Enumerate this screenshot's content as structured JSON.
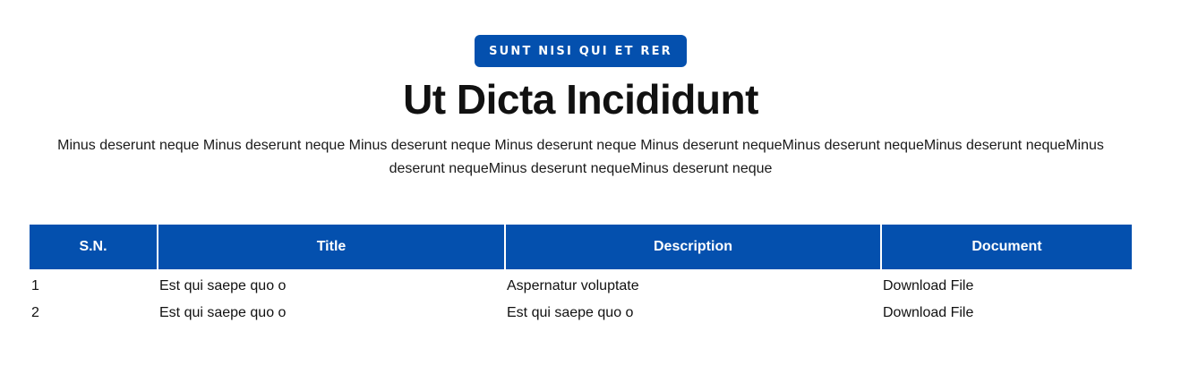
{
  "section": {
    "badge": "SUNT NISI QUI ET RER",
    "title": "Ut Dicta Incididunt",
    "description": "Minus deserunt neque Minus deserunt neque Minus deserunt neque Minus deserunt neque Minus deserunt nequeMinus deserunt nequeMinus deserunt nequeMinus deserunt nequeMinus deserunt nequeMinus deserunt neque"
  },
  "table": {
    "headers": {
      "sn": "S.N.",
      "title": "Title",
      "description": "Description",
      "document": "Document"
    },
    "rows": [
      {
        "sn": "1",
        "title": "Est qui saepe quo o",
        "description": "Aspernatur voluptate",
        "document": "Download File"
      },
      {
        "sn": "2",
        "title": "Est qui saepe quo o",
        "description": "Est qui saepe quo o",
        "document": "Download File"
      }
    ]
  },
  "colors": {
    "accent": "#0450AE",
    "text": "#111111",
    "background": "#FFFFFF"
  }
}
